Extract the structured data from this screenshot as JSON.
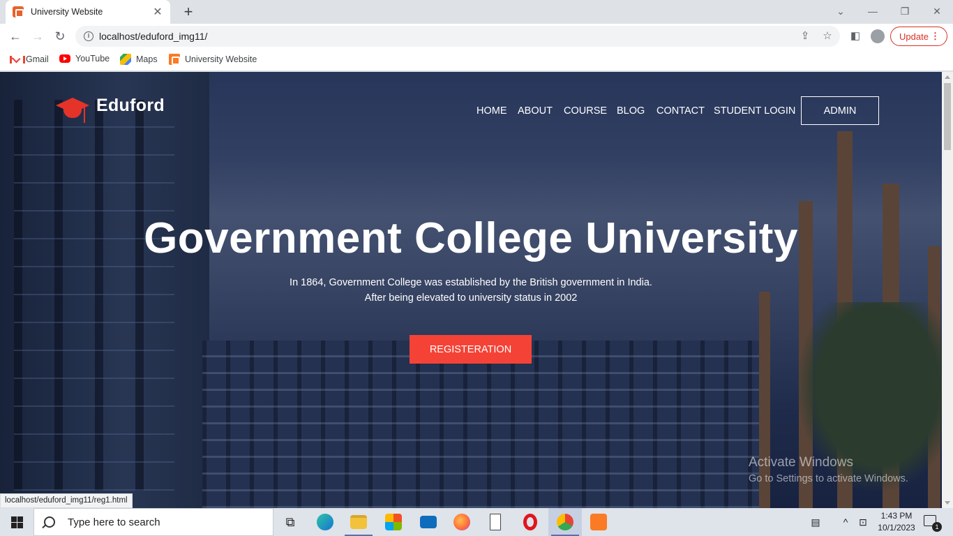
{
  "browser": {
    "tab_title": "University Website",
    "url": "localhost/eduford_img11/",
    "update_label": "Update",
    "bookmarks": [
      {
        "label": "Gmail",
        "icon": "gmail-icon"
      },
      {
        "label": "YouTube",
        "icon": "youtube-icon"
      },
      {
        "label": "Maps",
        "icon": "maps-icon"
      },
      {
        "label": "University Website",
        "icon": "xampp-icon"
      }
    ],
    "status_url": "localhost/eduford_img11/reg1.html"
  },
  "site": {
    "brand": "Eduford",
    "nav": [
      "HOME",
      "ABOUT",
      "COURSE",
      "BLOG",
      "CONTACT",
      "STUDENT LOGIN"
    ],
    "admin_label": "ADMIN",
    "hero_title": "Government College University",
    "hero_line1": "In 1864, Government College was established by the British government in India.",
    "hero_line2": "After being elevated to university status in 2002",
    "register_label": "REGISTERATION",
    "accent_color": "#f44336"
  },
  "watermark": {
    "line1": "Activate Windows",
    "line2": "Go to Settings to activate Windows."
  },
  "taskbar": {
    "search_placeholder": "Type here to search",
    "time": "1:43 PM",
    "date": "10/1/2023",
    "notification_count": "1"
  }
}
